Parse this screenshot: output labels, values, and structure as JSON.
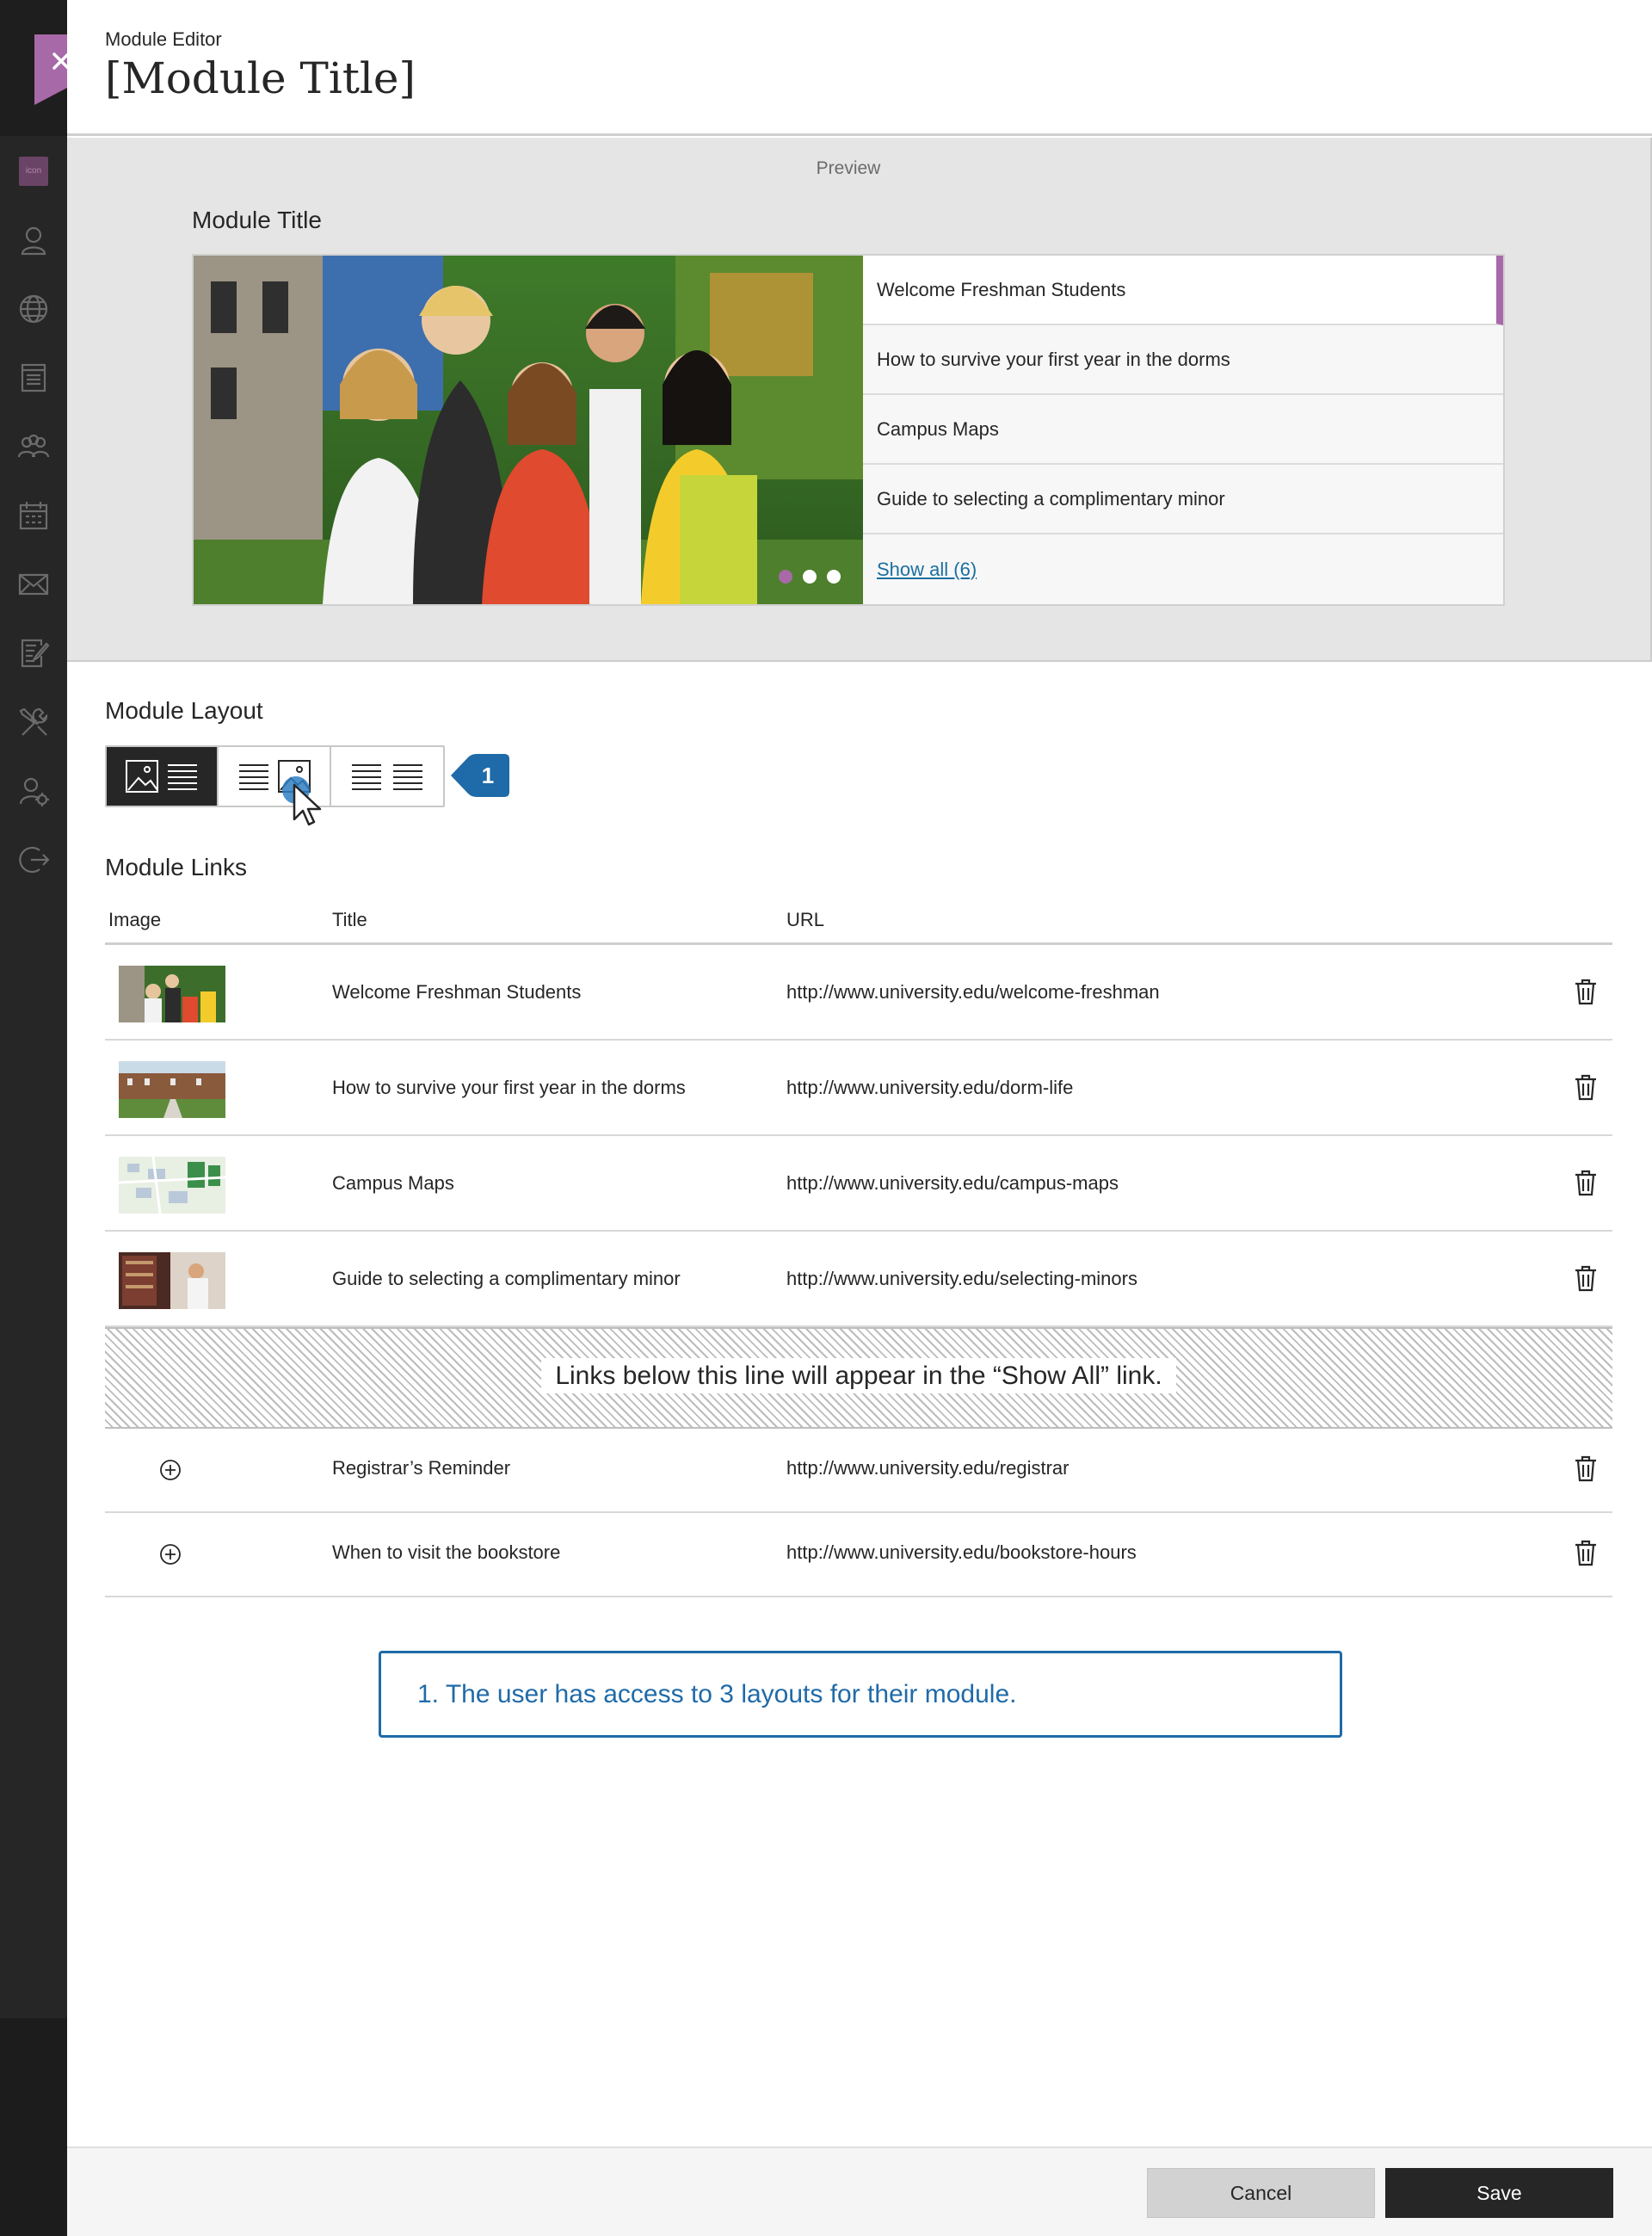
{
  "header": {
    "subtitle": "Module Editor",
    "title": "[Module Title]"
  },
  "nav": {
    "logo_text": "icon",
    "icons": [
      "profile-icon",
      "globe-icon",
      "courses-icon",
      "groups-icon",
      "calendar-icon",
      "messages-icon",
      "grades-icon",
      "tools-icon",
      "admin-user-icon",
      "sign-out-icon"
    ]
  },
  "preview": {
    "label": "Preview",
    "module_title": "Module Title",
    "links": [
      "Welcome Freshman Students",
      "How to survive your first year in the dorms",
      "Campus Maps",
      "Guide to selecting a complimentary minor"
    ],
    "show_all": "Show all (6)",
    "accent_color": "#a869a8"
  },
  "layout": {
    "title": "Module Layout",
    "options": [
      "image-left-list-layout",
      "list-image-right-layout",
      "two-column-list-layout"
    ],
    "selected_index": 0,
    "badge": "1"
  },
  "links_section": {
    "title": "Module Links",
    "columns": {
      "image": "Image",
      "title": "Title",
      "url": "URL"
    },
    "rows": [
      {
        "title": "Welcome Freshman Students",
        "url": "http://www.university.edu/welcome-freshman"
      },
      {
        "title": "How to survive your first year in the dorms",
        "url": "http://www.university.edu/dorm-life"
      },
      {
        "title": "Campus Maps",
        "url": "http://www.university.edu/campus-maps"
      },
      {
        "title": "Guide to selecting a complimentary minor",
        "url": "http://www.university.edu/selecting-minors"
      }
    ],
    "divider_text": "Links below this line will appear in the “Show All” link.",
    "extra_rows": [
      {
        "title": "Registrar’s Reminder",
        "url": "http://www.university.edu/registrar"
      },
      {
        "title": "When to visit the bookstore",
        "url": "http://www.university.edu/bookstore-hours"
      }
    ]
  },
  "annotation": {
    "text": "1. The user has access to 3 layouts for their module.",
    "color": "#1f6aa8"
  },
  "footer": {
    "cancel": "Cancel",
    "save": "Save"
  }
}
